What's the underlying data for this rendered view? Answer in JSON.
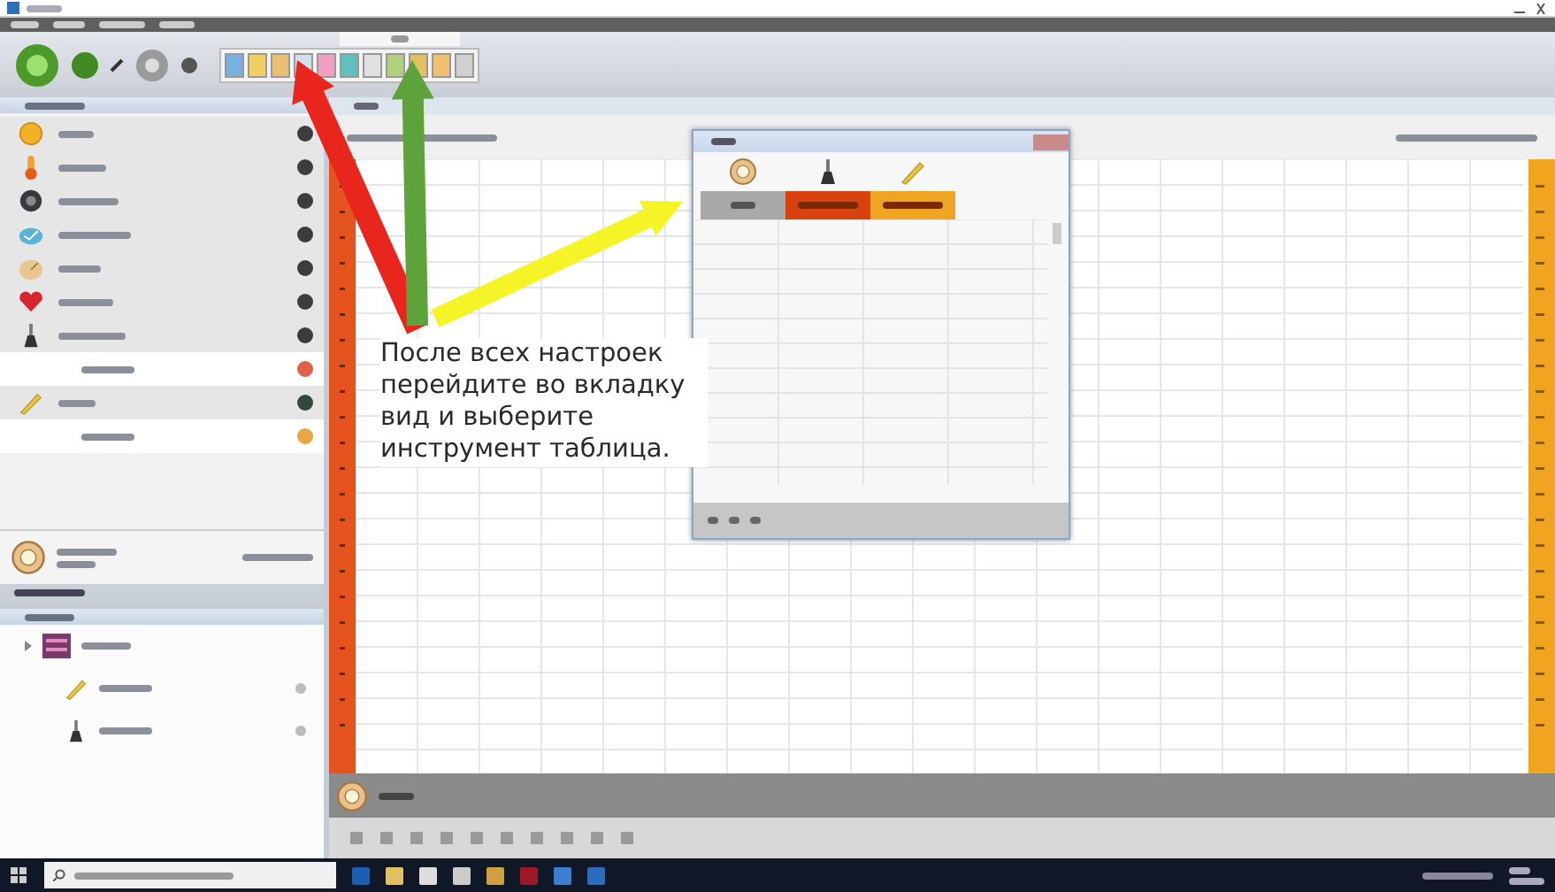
{
  "annotation": {
    "text": "После всех настроек перейдите во вкладку вид и выберите инструмент таблица."
  },
  "arrows": [
    {
      "color": "#e8261e"
    },
    {
      "color": "#5ea23c"
    },
    {
      "color": "#f4f426"
    }
  ],
  "sensors": [
    {
      "kind": "light",
      "color": "#3c3c3c"
    },
    {
      "kind": "temperature",
      "color": "#3c3c3c"
    },
    {
      "kind": "sound",
      "color": "#3c3c3c"
    },
    {
      "kind": "humidity",
      "color": "#3c3c3c"
    },
    {
      "kind": "pressure",
      "color": "#3c3c3c"
    },
    {
      "kind": "heart",
      "color": "#3c3c3c"
    },
    {
      "kind": "voltage",
      "color": "#3c3c3c",
      "children": [
        {
          "color": "#e0604a"
        }
      ]
    },
    {
      "kind": "force",
      "color": "#2f4a3a",
      "children": [
        {
          "color": "#eaa640"
        }
      ]
    }
  ],
  "project": {
    "children": [
      {
        "kind": "force"
      },
      {
        "kind": "voltage"
      }
    ]
  },
  "table_window": {
    "columns": [
      {
        "kind": "clock"
      },
      {
        "kind": "voltage"
      },
      {
        "kind": "force"
      }
    ],
    "cells": [
      {
        "color": "#a9a9a9"
      },
      {
        "color": "#d8420e"
      },
      {
        "color": "#f0a522"
      }
    ]
  }
}
